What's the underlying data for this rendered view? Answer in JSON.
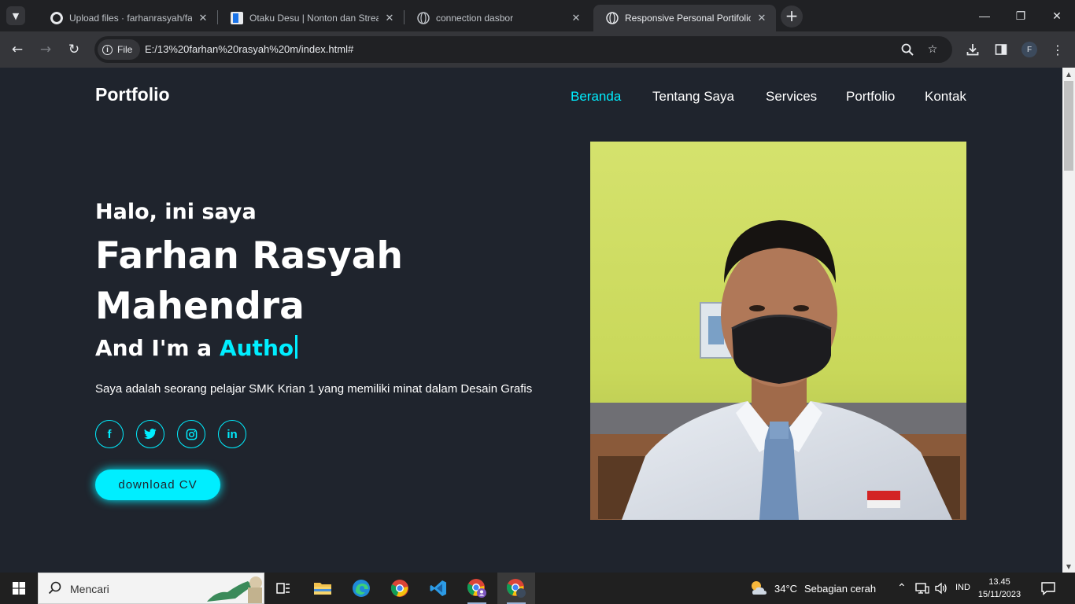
{
  "browser": {
    "tabs": [
      {
        "title": "Upload files · farhanrasyah/farhan",
        "favicon": "github-icon",
        "active": false
      },
      {
        "title": "Otaku Desu | Nonton dan Streaming",
        "favicon": "otakudesu-icon",
        "active": false
      },
      {
        "title": "connection dasbor",
        "favicon": "globe-icon",
        "active": false
      },
      {
        "title": "Responsive Personal Portifolio W",
        "favicon": "globe-icon",
        "active": true
      }
    ],
    "address": {
      "scheme_chip": "File",
      "url": "E:/13%20farhan%20rasyah%20m/index.html#"
    },
    "profile_initial": "F"
  },
  "site": {
    "logo": "Portfolio",
    "nav": [
      {
        "label": "Beranda",
        "active": true
      },
      {
        "label": "Tentang Saya",
        "active": false
      },
      {
        "label": "Services",
        "active": false
      },
      {
        "label": "Portfolio",
        "active": false
      },
      {
        "label": "Kontak",
        "active": false
      }
    ],
    "greeting": "Halo, ini saya",
    "name": "Farhan Rasyah Mahendra",
    "role_prefix": "And I'm a",
    "role_typed": "Autho",
    "description": "Saya adalah seorang pelajar SMK Krian 1 yang memiliki minat dalam Desain Grafis",
    "social": [
      {
        "icon": "facebook-icon",
        "glyph": "f"
      },
      {
        "icon": "twitter-icon",
        "glyph": ""
      },
      {
        "icon": "instagram-icon",
        "glyph": ""
      },
      {
        "icon": "linkedin-icon",
        "glyph": "in"
      }
    ],
    "cv_button": "download CV",
    "accent_color": "#00eeff",
    "background_color": "#1f242d"
  },
  "taskbar": {
    "search_placeholder": "Mencari",
    "weather_temp": "34°C",
    "weather_desc": "Sebagian cerah",
    "language": "IND",
    "time": "13.45",
    "date": "15/11/2023"
  }
}
